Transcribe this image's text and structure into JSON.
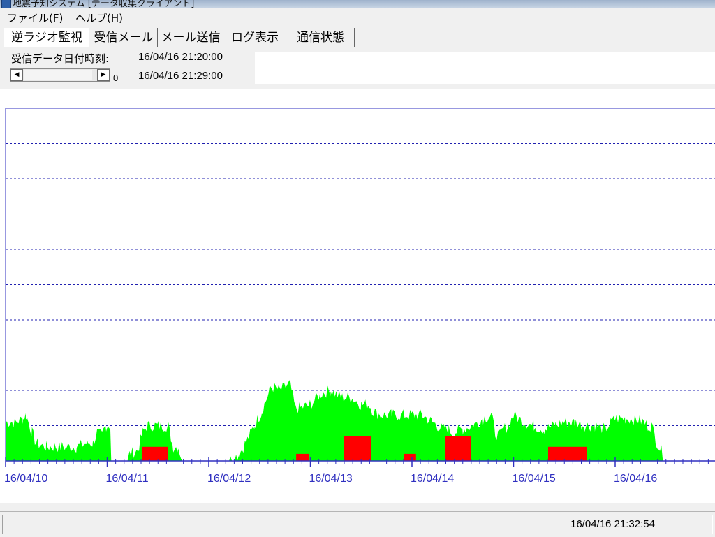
{
  "window": {
    "title": "地震予知システム [データ収集クライアント]"
  },
  "menu": [
    {
      "label": "ファイル(F)"
    },
    {
      "label": "ヘルプ(H)"
    }
  ],
  "tabs": [
    {
      "label": "逆ラジオ監視",
      "active": true
    },
    {
      "label": "受信メール",
      "active": false
    },
    {
      "label": "メール送信",
      "active": false
    },
    {
      "label": "ログ表示",
      "active": false
    },
    {
      "label": "通信状態",
      "active": false
    }
  ],
  "controls": {
    "received_label": "受信データ日付時刻:",
    "datetime_start": "16/04/16 21:20:00",
    "datetime_end": "16/04/16 21:29:00",
    "scroll_value": "0",
    "scroll_left_icon": "triangle-left-icon",
    "scroll_right_icon": "triangle-right-icon"
  },
  "status": {
    "panels": [
      "",
      "",
      "16/04/16 21:32:54"
    ]
  },
  "colors": {
    "axis": "#3030c0",
    "grid": "#2020b0",
    "green": "#00ff00",
    "red": "#ff0000"
  },
  "chart_data": {
    "type": "area",
    "title": "",
    "xlabel": "",
    "ylabel": "",
    "xlim": [
      "16/04/10",
      "16/04/17"
    ],
    "ylim": [
      0,
      10
    ],
    "grid": "horizontal dashed",
    "xticks": [
      "16/04/10",
      "16/04/11",
      "16/04/12",
      "16/04/13",
      "16/04/14",
      "16/04/15",
      "16/04/16"
    ],
    "series": [
      {
        "color": "#00ff00",
        "x_days": [
          0.0,
          0.05,
          0.1,
          0.17,
          0.2,
          0.26,
          0.3,
          0.4,
          0.5,
          0.6,
          0.7,
          0.8,
          0.86,
          0.9,
          0.95,
          0.97,
          0.99,
          1.0,
          1.03,
          1.04,
          1.05,
          1.2,
          1.22,
          1.3,
          1.35,
          1.4,
          1.5,
          1.6,
          1.65,
          1.7,
          1.74,
          1.8,
          1.85,
          1.95,
          2.0,
          2.05,
          2.1,
          2.15,
          2.2,
          2.3,
          2.38,
          2.45,
          2.52,
          2.6,
          2.62,
          2.7,
          2.8,
          2.85,
          2.9,
          3.0,
          3.1,
          3.2,
          3.3,
          3.4,
          3.5,
          3.58,
          3.62,
          3.7,
          3.8,
          3.9,
          4.0,
          4.1,
          4.2,
          4.25,
          4.3,
          4.33,
          4.36,
          4.4,
          4.5,
          4.6,
          4.7,
          4.78,
          4.82,
          4.86,
          4.9,
          4.95,
          5.0,
          5.1,
          5.2,
          5.3,
          5.4,
          5.5,
          5.6,
          5.7,
          5.8,
          5.9,
          6.0,
          6.1,
          6.2,
          6.28,
          6.32,
          6.36,
          6.4,
          6.5,
          6.6,
          7.0
        ],
        "values": [
          1.1,
          1.1,
          1.1,
          1.2,
          1.3,
          0.8,
          0.5,
          0.4,
          0.4,
          0.4,
          0.4,
          0.5,
          0.5,
          0.8,
          0.7,
          0.9,
          1.0,
          1.0,
          1.0,
          0.0,
          0.0,
          0.0,
          0.2,
          0.3,
          0.8,
          1.0,
          1.0,
          1.0,
          0.4,
          0.4,
          0.0,
          0.0,
          0.0,
          0.0,
          0.0,
          0.0,
          0.0,
          0.0,
          0.0,
          0.2,
          0.6,
          1.0,
          1.4,
          2.0,
          2.1,
          2.0,
          2.2,
          1.5,
          1.5,
          1.6,
          1.9,
          2.0,
          1.8,
          1.8,
          1.6,
          1.6,
          1.4,
          1.3,
          1.3,
          1.3,
          1.3,
          1.3,
          1.1,
          1.0,
          0.9,
          0.9,
          0.9,
          0.8,
          0.9,
          1.0,
          1.2,
          1.3,
          0.8,
          0.7,
          0.9,
          1.0,
          1.3,
          1.1,
          1.0,
          0.9,
          1.0,
          1.1,
          1.1,
          1.0,
          1.0,
          0.9,
          1.2,
          1.2,
          1.2,
          1.1,
          1.0,
          1.0,
          0.6,
          0.0,
          0.0,
          0.0
        ]
      },
      {
        "color": "#ff0000",
        "x_days": [],
        "values": []
      }
    ]
  }
}
